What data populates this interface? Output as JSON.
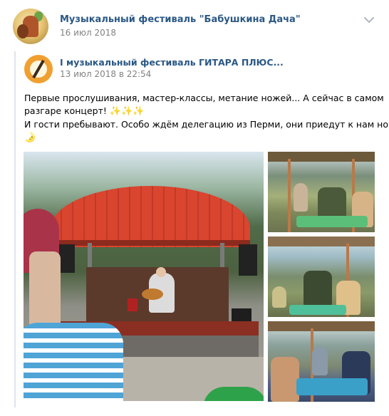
{
  "author": {
    "name": "Музыкальный фестиваль \"Бабушкина Дача\"",
    "date": "16 июл 2018"
  },
  "repost": {
    "name": "I музыкальный фестиваль ГИТАРА ПЛЮС...",
    "date": "13 июл 2018 в 22:54"
  },
  "text": {
    "line1": "Первые прослушивания, мастер-классы, метание ножей... А сейчас в самом",
    "line2": "разгаре концерт!",
    "line2_emoji": "✨✨✨",
    "line3": "И гости пребывают. Особо ждём делегацию из Перми, они приедут к нам ночью",
    "line4_emoji": "🌛"
  },
  "icons": {
    "more": "chevron-down-icon"
  },
  "colors": {
    "link": "#2a5885",
    "meta": "#828282",
    "repost_bar": "#dfe4ea"
  }
}
